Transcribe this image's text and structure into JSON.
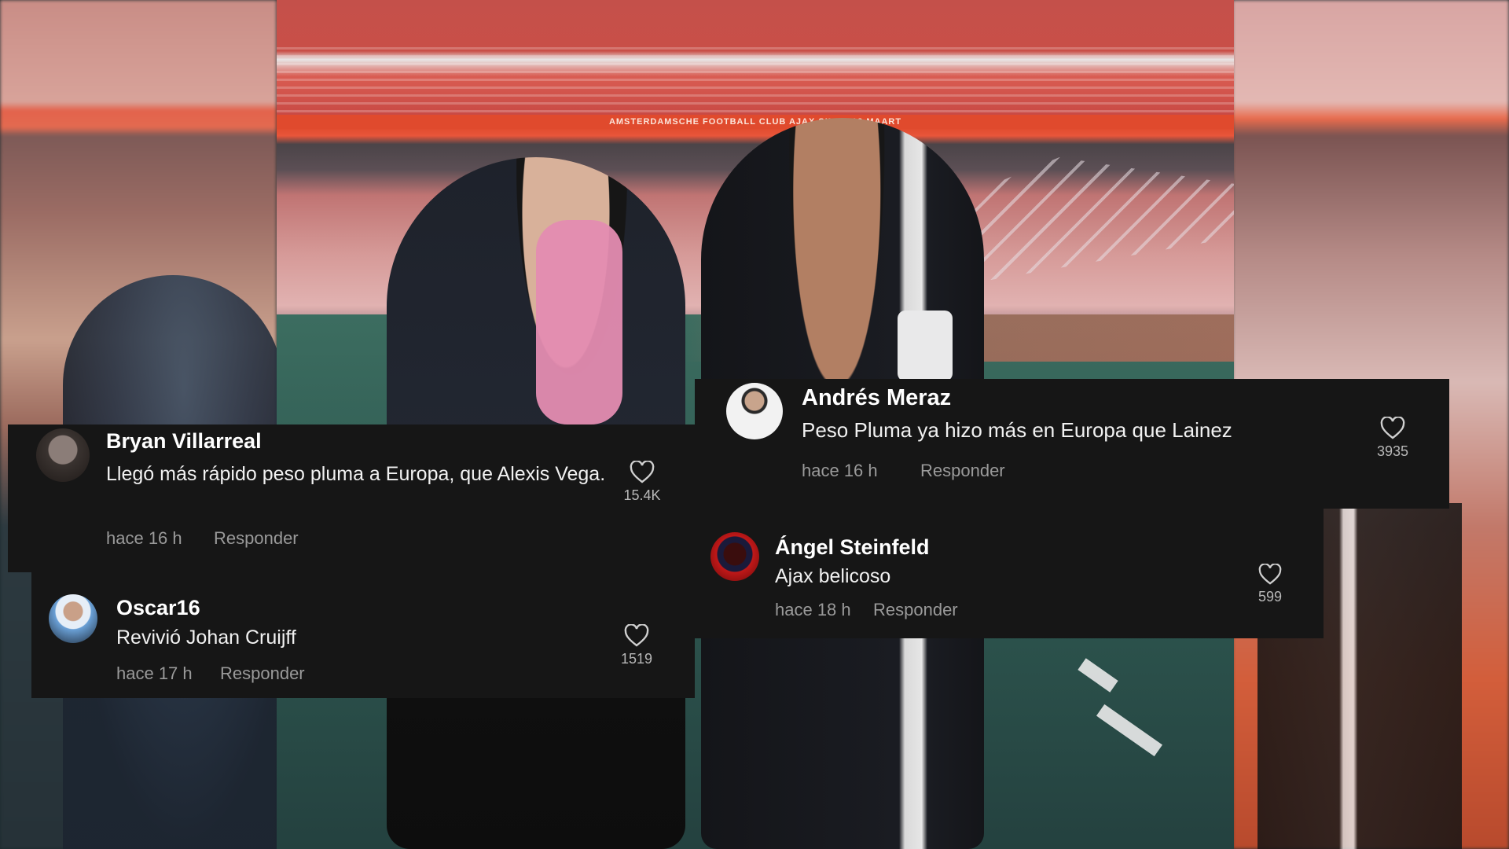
{
  "photo": {
    "banner_text": "AMSTERDAMSCHE FOOTBALL CLUB AJAX SINDS 18 MAART"
  },
  "comments": [
    {
      "username": "Bryan Villarreal",
      "text": "Llegó más rápido peso pluma a Europa, que Alexis Vega.",
      "time": "hace 16 h",
      "reply_label": "Responder",
      "likes": "15.4K"
    },
    {
      "username": "Oscar16",
      "text": "Revivió Johan Cruijff",
      "time": "hace 17 h",
      "reply_label": "Responder",
      "likes": "1519"
    },
    {
      "username": "Andrés  Meraz",
      "text": "Peso Pluma ya hizo más en Europa que Lainez",
      "time": "hace 16 h",
      "reply_label": "Responder",
      "likes": "3935"
    },
    {
      "username": "Ángel Steinfeld",
      "text": "Ajax belicoso",
      "time": "hace 18 h",
      "reply_label": "Responder",
      "likes": "599"
    }
  ],
  "colors": {
    "card_bg": "#161616",
    "meta_text": "#9a9a9a",
    "banner_red": "#e04a2d"
  },
  "icons": {
    "like": "heart-outline-icon",
    "avatar": "user-avatar"
  }
}
